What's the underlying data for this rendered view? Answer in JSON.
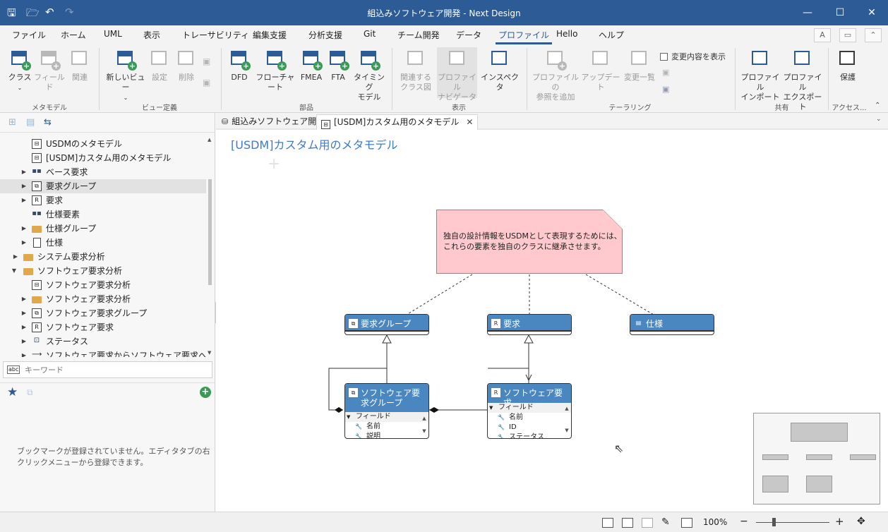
{
  "window": {
    "title": "組込みソフトウェア開発 - Next Design",
    "minimize": "—",
    "maximize": "☐",
    "close": "✕"
  },
  "quick_access": {
    "save": "🖫",
    "open": "🗁",
    "undo": "↶",
    "redo": "↷"
  },
  "ribbon_tabs": [
    "ファイル",
    "ホーム",
    "UML",
    "表示",
    "トレーサビリティ",
    "編集支援",
    "分析支援",
    "Git",
    "チーム開発",
    "データ",
    "プロファイル",
    "Hello",
    "ヘルプ"
  ],
  "active_tab": "プロファイル",
  "ribbon": {
    "class_btn": "クラス",
    "field_btn": "フィールド",
    "relation_btn": "関連",
    "new_view_btn": "新しいビュー",
    "settings_btn": "設定",
    "delete_btn": "削除",
    "dfd_btn": "DFD",
    "flowchart_btn": "フローチャート",
    "fmea_btn": "FMEA",
    "fta_btn": "FTA",
    "timing_btn_l1": "タイミング",
    "timing_btn_l2": "モデル",
    "related_btn_l1": "関連する",
    "related_btn_l2": "クラス図",
    "profile_nav_l1": "プロファイル",
    "profile_nav_l2": "ナビゲータ",
    "inspector_btn": "インスペクタ",
    "profile_ref_l1": "プロファイルの",
    "profile_ref_l2": "参照を追加",
    "update_btn": "アップデート",
    "change_list_btn": "変更一覧",
    "show_changes_chk": "変更内容を表示",
    "profile_import_l1": "プロファイル",
    "profile_import_l2": "インポート",
    "profile_export_l1": "プロファイル",
    "profile_export_l2": "エクスポート",
    "protect_btn": "保護",
    "group_metamodel": "メタモデル",
    "group_view": "ビュー定義",
    "group_parts": "部品",
    "group_display": "表示",
    "group_tailoring": "テーラリング",
    "group_share": "共有",
    "group_access": "アクセス..."
  },
  "tree": [
    {
      "label": "USDMのメタモデル",
      "icon": "frame",
      "level": 2,
      "arrow": ""
    },
    {
      "label": "[USDM]カスタム用のメタモデル",
      "icon": "frame",
      "level": 2,
      "arrow": ""
    },
    {
      "label": "ベース要求",
      "icon": "dots",
      "level": 2,
      "arrow": "▶"
    },
    {
      "label": "要求グループ",
      "icon": "frame",
      "level": 2,
      "arrow": "▶",
      "selected": true
    },
    {
      "label": "要求",
      "icon": "frame",
      "level": 2,
      "arrow": "▶"
    },
    {
      "label": "仕様要素",
      "icon": "dots",
      "level": 2,
      "arrow": ""
    },
    {
      "label": "仕様グループ",
      "icon": "folder",
      "level": 2,
      "arrow": "▶"
    },
    {
      "label": "仕様",
      "icon": "doc",
      "level": 2,
      "arrow": "▶"
    },
    {
      "label": "システム要求分析",
      "icon": "folder",
      "level": 1,
      "arrow": "▶"
    },
    {
      "label": "ソフトウェア要求分析",
      "icon": "folder",
      "level": 1,
      "arrow": "▼"
    },
    {
      "label": "ソフトウェア要求分析",
      "icon": "frame",
      "level": 2,
      "arrow": ""
    },
    {
      "label": "ソフトウェア要求分析",
      "icon": "folder",
      "level": 2,
      "arrow": "▶"
    },
    {
      "label": "ソフトウェア要求グループ",
      "icon": "frame",
      "level": 2,
      "arrow": "▶"
    },
    {
      "label": "ソフトウェア要求",
      "icon": "frame",
      "level": 2,
      "arrow": "▶"
    },
    {
      "label": "ステータス",
      "icon": "dots",
      "level": 2,
      "arrow": "▶"
    },
    {
      "label": "ソフトウェア要求からソフトウェア要求への参照",
      "icon": "arrow",
      "level": 2,
      "arrow": "▶"
    }
  ],
  "keyword_placeholder": "キーワード",
  "bookmark_msg": "ブックマークが登録されていません。エディタタブの右クリックメニューから登録できます。",
  "editor_tabs": [
    {
      "label": "組込みソフトウェア開発"
    },
    {
      "label": "[USDM]カスタム用のメタモデル"
    }
  ],
  "canvas": {
    "title": "[USDM]カスタム用のメタモデル",
    "note_line1": "独自の設計情報をUSDMとして表現するためには、",
    "note_line2": "これらの要素を独自のクラスに継承させます。",
    "class_req_group": "要求グループ",
    "class_req": "要求",
    "class_spec": "仕様",
    "class_sw_group": "ソフトウェア要求グループ",
    "class_sw_req": "ソフトウェア要求",
    "fields_label": "フィールド",
    "sw_group_fields": [
      "名前",
      "説明"
    ],
    "sw_req_fields": [
      "名前",
      "ID",
      "ステータス"
    ]
  },
  "status": {
    "zoom": "100%",
    "minus": "−",
    "plus": "+"
  },
  "icons": {
    "close_tab": "close-icon",
    "star": "star-icon"
  }
}
